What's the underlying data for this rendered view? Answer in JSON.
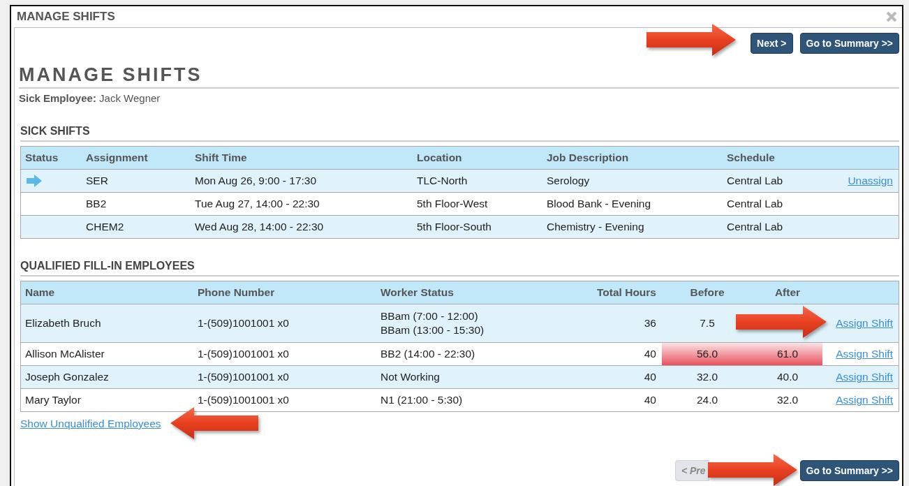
{
  "window": {
    "title": "MANAGE SHIFTS"
  },
  "top_buttons": [
    {
      "label": "Next >",
      "kind": "primary"
    },
    {
      "label": "Go to Summary >>",
      "kind": "primary"
    }
  ],
  "heading": "MANAGE SHIFTS",
  "sick_employee": {
    "label": "Sick Employee:",
    "value": "Jack Wegner"
  },
  "sick_shifts": {
    "title": "SICK SHIFTS",
    "columns": [
      "Status",
      "Assignment",
      "Shift Time",
      "Location",
      "Job Description",
      "Schedule"
    ],
    "rows": [
      {
        "current": true,
        "assignment": "SER",
        "shift_time": "Mon Aug 26, 9:00 - 17:30",
        "location": "TLC-North",
        "job_description": "Serology",
        "schedule": "Central Lab",
        "action": "Unassign"
      },
      {
        "current": false,
        "assignment": "BB2",
        "shift_time": "Tue Aug 27, 14:00 - 22:30",
        "location": "5th Floor-West",
        "job_description": "Blood Bank - Evening",
        "schedule": "Central Lab"
      },
      {
        "current": false,
        "assignment": "CHEM2",
        "shift_time": "Wed Aug 28, 14:00 - 22:30",
        "location": "5th Floor-South",
        "job_description": "Chemistry - Evening",
        "schedule": "Central Lab"
      }
    ]
  },
  "qualified": {
    "title": "QUALIFIED FILL-IN EMPLOYEES",
    "columns": [
      "Name",
      "Phone Number",
      "Worker Status",
      "Total Hours",
      "Before",
      "After"
    ],
    "rows": [
      {
        "name": "Elizabeth Bruch",
        "phone": "1-(509)1001001 x0",
        "worker_status": [
          "BBam (7:00 - 12:00)",
          "BBam (13:00 - 15:30)"
        ],
        "total_hours": "36",
        "before": "7.5",
        "over_limit": false,
        "action": "Assign Shift"
      },
      {
        "name": "Allison McAlister",
        "phone": "1-(509)1001001 x0",
        "worker_status": [
          "BB2 (14:00 - 22:30)"
        ],
        "total_hours": "40",
        "before": "56.0",
        "after": "61.0",
        "over_limit": true,
        "action": "Assign Shift"
      },
      {
        "name": "Joseph Gonzalez",
        "phone": "1-(509)1001001 x0",
        "worker_status": [
          "Not Working"
        ],
        "total_hours": "40",
        "before": "32.0",
        "after": "40.0",
        "over_limit": false,
        "action": "Assign Shift"
      },
      {
        "name": "Mary Taylor",
        "phone": "1-(509)1001001 x0",
        "worker_status": [
          "N1 (21:00 - 5:30)"
        ],
        "total_hours": "40",
        "before": "24.0",
        "after": "32.0",
        "over_limit": false,
        "action": "Assign Shift"
      }
    ]
  },
  "show_unqualified_link": "Show Unqualified Employees",
  "bottom_buttons": [
    {
      "label": "< Pre",
      "kind": "disabled"
    },
    {
      "label": "Go to Summary >>",
      "kind": "primary"
    }
  ]
}
